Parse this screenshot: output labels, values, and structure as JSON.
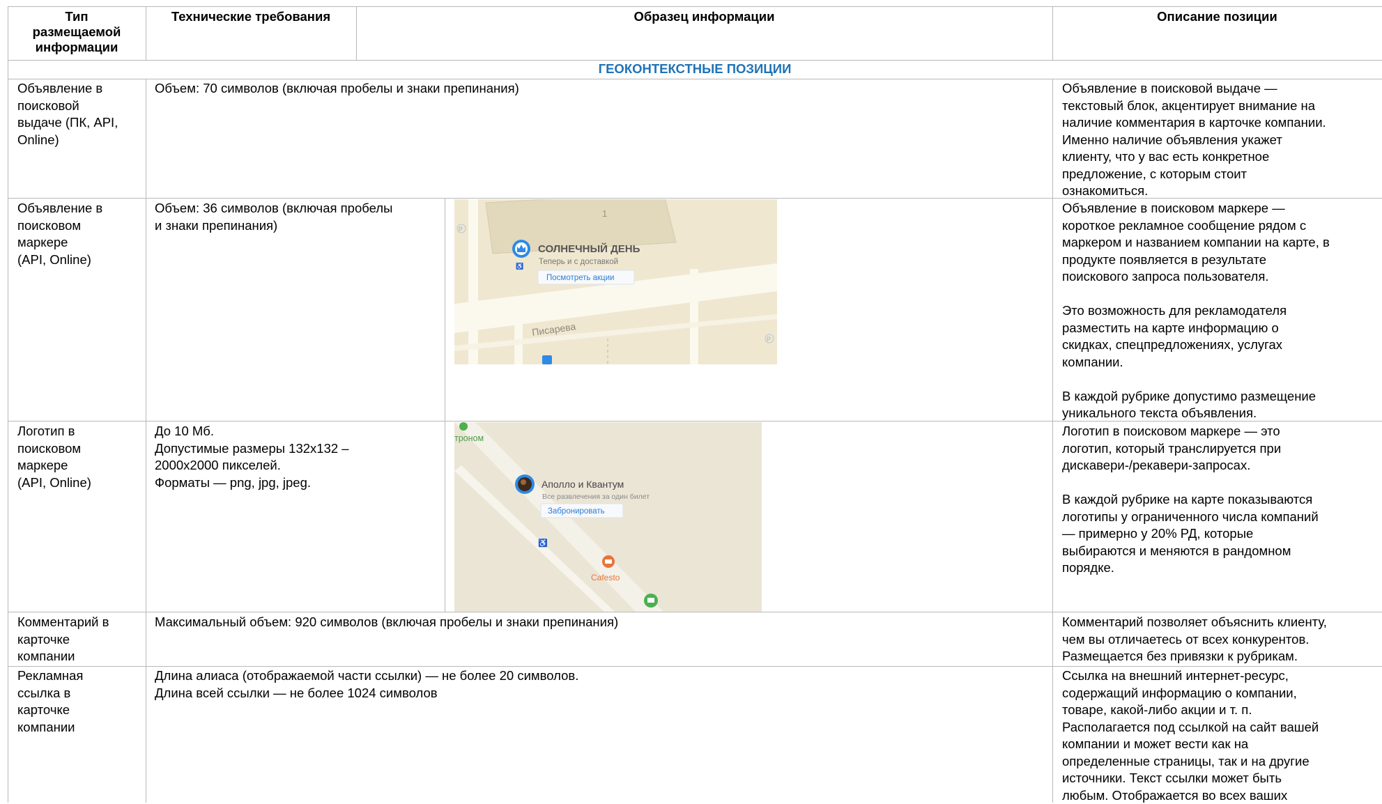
{
  "headers": {
    "type": "Тип\nразмещаемой\nинформации",
    "requirements": "Технические требования",
    "sample": "Образец информации",
    "description": "Описание позиции"
  },
  "section_title": "ГЕОКОНТЕКСТНЫЕ ПОЗИЦИИ",
  "rows": [
    {
      "type": "Объявление в\nпоисковой\nвыдаче (ПК, API,\nOnline)",
      "requirements": "Объем: 70 символов (включая пробелы и знаки препинания)",
      "description": "Объявление в поисковой выдаче —\nтекстовый блок, акцентирует внимание на\nналичие комментария в карточке компании.\nИменно наличие объявления укажет\nклиенту, что у вас есть конкретное\nпредложение, с которым стоит\nознакомиться."
    },
    {
      "type": "Объявление в\nпоисковом\nмаркере\n(API, Online)",
      "requirements": "Объем: 36 символов (включая пробелы\nи знаки препинания)",
      "description": "Объявление в поисковом маркере —\nкороткое рекламное сообщение рядом с\nмаркером и названием компании на карте, в\nпродукте появляется в результате\nпоискового запроса пользователя.\n\nЭто возможность для рекламодателя\nразместить на карте информацию о\nскидках, спецпредложениях, услугах\nкомпании.\n\nВ каждой рубрике допустимо размещение\nуникального текста объявления."
    },
    {
      "type": "Логотип в\nпоисковом\nмаркере\n(API, Online)",
      "requirements": "До 10 Мб.\nДопустимые размеры 132х132 –\n2000х2000 пикселей.\nФорматы — png, jpg, jpeg.",
      "description": "Логотип в поисковом маркере — это\nлоготип, который транслируется при\nдискавери-/рекавери-запросах.\n\nВ каждой рубрике на карте показываются\nлоготипы у ограниченного числа компаний\n— примерно у 20% РД, которые\nвыбираются и меняются в рандомном\nпорядке."
    },
    {
      "type": "Комментарий в\nкарточке\nкомпании",
      "requirements": "Максимальный объем: 920 символов (включая пробелы и знаки препинания)",
      "description": "Комментарий позволяет объяснить клиенту,\nчем вы отличаетесь от всех конкурентов.\nРазмещается без привязки к рубрикам."
    },
    {
      "type": "Рекламная\nссылка в\nкарточке\nкомпании",
      "requirements": "Длина алиаса (отображаемой части ссылки) — не более 20 символов.\nДлина всей ссылки — не более 1024 символов",
      "description": "Ссылка на внешний интернет-ресурс,\nсодержащий информацию о компании,\nтоваре, какой-либо акции и т. п.\nРасполагается под ссылкой на сайт вашей\nкомпании и может вести как на\nопределенные страницы, так и на другие\nисточники. Текст ссылки может быть\nлюбым. Отображается во всех ваших"
    }
  ],
  "map1": {
    "building_number": "1",
    "company": "СОЛНЕЧНЫЙ ДЕНЬ",
    "ad_text": "Теперь и с доставкой",
    "button": "Посмотреть акции",
    "street": "Писарева",
    "parking": "P",
    "colors": {
      "bg": "#efe7cf",
      "road": "#fbf8ee",
      "building": "#e2d9bd",
      "marker": "#2e8ae6"
    }
  },
  "map2": {
    "corner_label": "троном",
    "company": "Аполло и Квантум",
    "ad_text": "Все развлечения за один билет",
    "button": "Забронировать",
    "cafe": "Cafesto",
    "colors": {
      "bg": "#ebe5d6",
      "road": "#f4f1e8",
      "marker": "#2e8ae6",
      "cafe": "#e8743b",
      "shop": "#4caf50"
    }
  }
}
